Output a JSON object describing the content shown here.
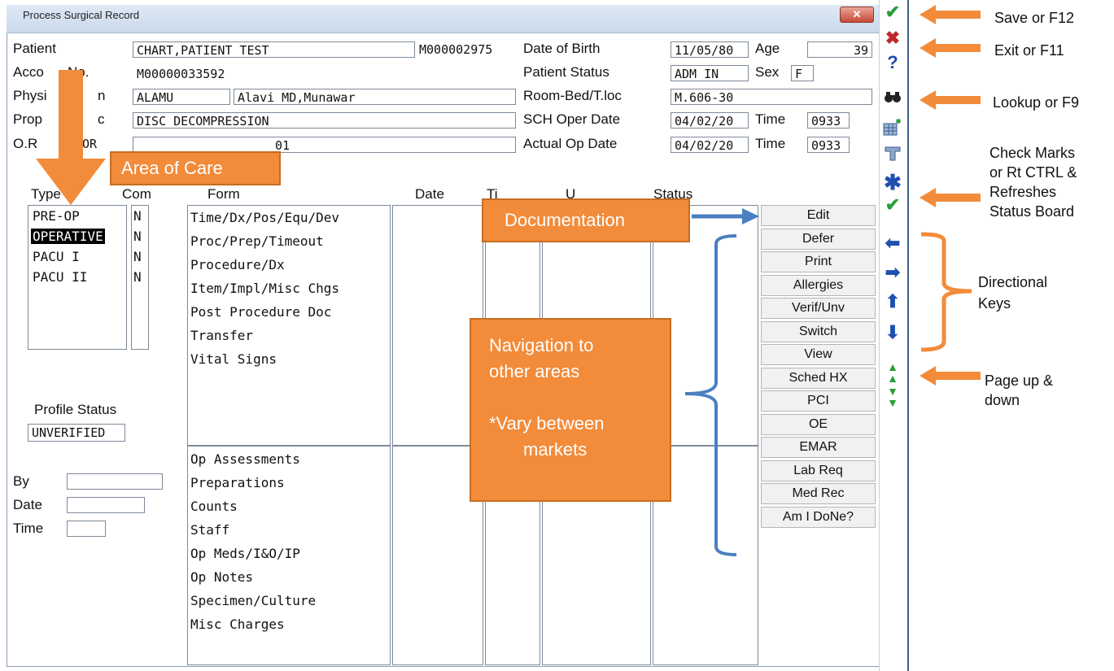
{
  "window": {
    "title": "Process Surgical Record",
    "close_label": "✕"
  },
  "header": {
    "patient_label": "Patient",
    "patient_value": "CHART,PATIENT TEST",
    "patient_id": "M000002975",
    "account_label": "Acco",
    "account_label_tail": "No.",
    "account_value": "M00000033592",
    "physician_label": "Physi",
    "physician_label_tail": "n",
    "physician_code": "ALAMU",
    "physician_name": "Alavi MD,Munawar",
    "proc_label": "Prop",
    "proc_label_tail": "c",
    "proc_value": "DISC DECOMPRESSION",
    "or_label": "O.R",
    "or_label_tail": "MOR",
    "or_value": "01",
    "dob_label": "Date of Birth",
    "dob_value": "11/05/80",
    "age_label": "Age",
    "age_value": "39",
    "status_label": "Patient Status",
    "status_value": "ADM IN",
    "sex_label": "Sex",
    "sex_value": "F",
    "room_label": "Room-Bed/T.loc",
    "room_value": "M.606-30",
    "sch_label": "SCH Oper Date",
    "sch_date": "04/02/20",
    "sch_time_label": "Time",
    "sch_time": "0933",
    "actual_label": "Actual Op Date",
    "actual_date": "04/02/20",
    "actual_time_label": "Time",
    "actual_time": "0933"
  },
  "columns": {
    "type": "Type",
    "com": "Com",
    "form": "Form",
    "date": "Date",
    "time": "Ti",
    "user": "U",
    "status": "Status"
  },
  "types": [
    {
      "label": "PRE-OP",
      "com": "N"
    },
    {
      "label": "OPERATIVE",
      "com": "N"
    },
    {
      "label": "PACU I",
      "com": "N"
    },
    {
      "label": "PACU II",
      "com": "N"
    }
  ],
  "forms_top": [
    "Time/Dx/Pos/Equ/Dev",
    "Proc/Prep/Timeout",
    "Procedure/Dx",
    "Item/Impl/Misc Chgs",
    "Post Procedure Doc",
    "Transfer",
    "Vital Signs"
  ],
  "forms_bottom": [
    "Op Assessments",
    "Preparations",
    "Counts",
    "Staff",
    "Op Meds/I&O/IP",
    "Op Notes",
    "Specimen/Culture",
    "Misc Charges"
  ],
  "profile": {
    "label": "Profile Status",
    "value": "UNVERIFIED",
    "by_label": "By",
    "date_label": "Date",
    "time_label": "Time"
  },
  "nav_buttons": [
    "Edit",
    "Defer",
    "Print",
    "Allergies",
    "Verif/Unv",
    "Switch",
    "View",
    "Sched HX",
    "PCI",
    "OE",
    "EMAR",
    "Lab Req",
    "Med Rec",
    "Am I DoNe?"
  ],
  "toolbar_icons": [
    "save-check-icon",
    "exit-x-icon",
    "help-question-icon",
    "lookup-binoculars-icon",
    "grid-icon",
    "filter-icon",
    "asterisk-icon",
    "check-all-icon",
    "arrow-left-icon",
    "arrow-right-icon",
    "arrow-up-icon",
    "arrow-down-icon",
    "page-up-icon",
    "page-down-icon"
  ],
  "annotations": {
    "save": "Save or F12",
    "exit": "Exit or F11",
    "lookup": "Lookup or F9",
    "check_marks": [
      "Check Marks",
      "or Rt CTRL &",
      "Refreshes",
      "Status Board"
    ],
    "directional": [
      "Directional",
      "Keys"
    ],
    "page": [
      "Page up &",
      "down"
    ],
    "area_of_care": "Area of Care",
    "documentation": "Documentation",
    "navigation": [
      "Navigation to",
      "other areas",
      "",
      "*Vary between",
      "markets"
    ]
  },
  "colors": {
    "accent_orange": "#f28b3a",
    "arrow_blue": "#4a7fc1",
    "selection": "#000000"
  }
}
